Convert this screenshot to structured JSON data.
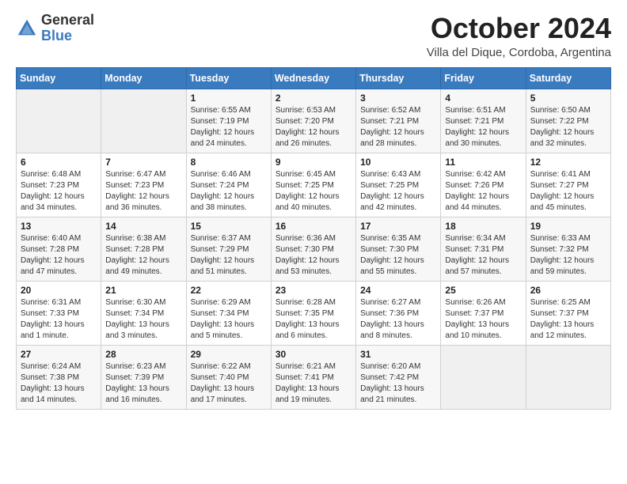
{
  "logo": {
    "general": "General",
    "blue": "Blue"
  },
  "header": {
    "month": "October 2024",
    "location": "Villa del Dique, Cordoba, Argentina"
  },
  "days": [
    "Sunday",
    "Monday",
    "Tuesday",
    "Wednesday",
    "Thursday",
    "Friday",
    "Saturday"
  ],
  "weeks": [
    [
      {
        "day": "",
        "content": ""
      },
      {
        "day": "",
        "content": ""
      },
      {
        "day": "1",
        "content": "Sunrise: 6:55 AM\nSunset: 7:19 PM\nDaylight: 12 hours and 24 minutes."
      },
      {
        "day": "2",
        "content": "Sunrise: 6:53 AM\nSunset: 7:20 PM\nDaylight: 12 hours and 26 minutes."
      },
      {
        "day": "3",
        "content": "Sunrise: 6:52 AM\nSunset: 7:21 PM\nDaylight: 12 hours and 28 minutes."
      },
      {
        "day": "4",
        "content": "Sunrise: 6:51 AM\nSunset: 7:21 PM\nDaylight: 12 hours and 30 minutes."
      },
      {
        "day": "5",
        "content": "Sunrise: 6:50 AM\nSunset: 7:22 PM\nDaylight: 12 hours and 32 minutes."
      }
    ],
    [
      {
        "day": "6",
        "content": "Sunrise: 6:48 AM\nSunset: 7:23 PM\nDaylight: 12 hours and 34 minutes."
      },
      {
        "day": "7",
        "content": "Sunrise: 6:47 AM\nSunset: 7:23 PM\nDaylight: 12 hours and 36 minutes."
      },
      {
        "day": "8",
        "content": "Sunrise: 6:46 AM\nSunset: 7:24 PM\nDaylight: 12 hours and 38 minutes."
      },
      {
        "day": "9",
        "content": "Sunrise: 6:45 AM\nSunset: 7:25 PM\nDaylight: 12 hours and 40 minutes."
      },
      {
        "day": "10",
        "content": "Sunrise: 6:43 AM\nSunset: 7:25 PM\nDaylight: 12 hours and 42 minutes."
      },
      {
        "day": "11",
        "content": "Sunrise: 6:42 AM\nSunset: 7:26 PM\nDaylight: 12 hours and 44 minutes."
      },
      {
        "day": "12",
        "content": "Sunrise: 6:41 AM\nSunset: 7:27 PM\nDaylight: 12 hours and 45 minutes."
      }
    ],
    [
      {
        "day": "13",
        "content": "Sunrise: 6:40 AM\nSunset: 7:28 PM\nDaylight: 12 hours and 47 minutes."
      },
      {
        "day": "14",
        "content": "Sunrise: 6:38 AM\nSunset: 7:28 PM\nDaylight: 12 hours and 49 minutes."
      },
      {
        "day": "15",
        "content": "Sunrise: 6:37 AM\nSunset: 7:29 PM\nDaylight: 12 hours and 51 minutes."
      },
      {
        "day": "16",
        "content": "Sunrise: 6:36 AM\nSunset: 7:30 PM\nDaylight: 12 hours and 53 minutes."
      },
      {
        "day": "17",
        "content": "Sunrise: 6:35 AM\nSunset: 7:30 PM\nDaylight: 12 hours and 55 minutes."
      },
      {
        "day": "18",
        "content": "Sunrise: 6:34 AM\nSunset: 7:31 PM\nDaylight: 12 hours and 57 minutes."
      },
      {
        "day": "19",
        "content": "Sunrise: 6:33 AM\nSunset: 7:32 PM\nDaylight: 12 hours and 59 minutes."
      }
    ],
    [
      {
        "day": "20",
        "content": "Sunrise: 6:31 AM\nSunset: 7:33 PM\nDaylight: 13 hours and 1 minute."
      },
      {
        "day": "21",
        "content": "Sunrise: 6:30 AM\nSunset: 7:34 PM\nDaylight: 13 hours and 3 minutes."
      },
      {
        "day": "22",
        "content": "Sunrise: 6:29 AM\nSunset: 7:34 PM\nDaylight: 13 hours and 5 minutes."
      },
      {
        "day": "23",
        "content": "Sunrise: 6:28 AM\nSunset: 7:35 PM\nDaylight: 13 hours and 6 minutes."
      },
      {
        "day": "24",
        "content": "Sunrise: 6:27 AM\nSunset: 7:36 PM\nDaylight: 13 hours and 8 minutes."
      },
      {
        "day": "25",
        "content": "Sunrise: 6:26 AM\nSunset: 7:37 PM\nDaylight: 13 hours and 10 minutes."
      },
      {
        "day": "26",
        "content": "Sunrise: 6:25 AM\nSunset: 7:37 PM\nDaylight: 13 hours and 12 minutes."
      }
    ],
    [
      {
        "day": "27",
        "content": "Sunrise: 6:24 AM\nSunset: 7:38 PM\nDaylight: 13 hours and 14 minutes."
      },
      {
        "day": "28",
        "content": "Sunrise: 6:23 AM\nSunset: 7:39 PM\nDaylight: 13 hours and 16 minutes."
      },
      {
        "day": "29",
        "content": "Sunrise: 6:22 AM\nSunset: 7:40 PM\nDaylight: 13 hours and 17 minutes."
      },
      {
        "day": "30",
        "content": "Sunrise: 6:21 AM\nSunset: 7:41 PM\nDaylight: 13 hours and 19 minutes."
      },
      {
        "day": "31",
        "content": "Sunrise: 6:20 AM\nSunset: 7:42 PM\nDaylight: 13 hours and 21 minutes."
      },
      {
        "day": "",
        "content": ""
      },
      {
        "day": "",
        "content": ""
      }
    ]
  ]
}
